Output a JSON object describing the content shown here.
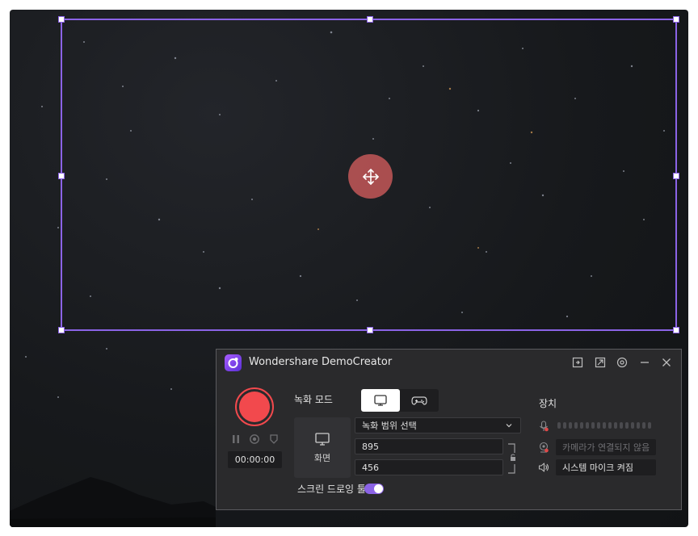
{
  "app": {
    "title": "Wondershare DemoCreator"
  },
  "recording": {
    "timer": "00:00:00"
  },
  "mode": {
    "label": "녹화 모드"
  },
  "area": {
    "screen_label": "화면",
    "select_label": "녹화 범위 선택",
    "width": "895",
    "height": "456"
  },
  "drawing_tool": {
    "label": "스크린 드로잉 툴",
    "enabled": true
  },
  "device": {
    "label": "장치",
    "camera": "카메라가 연결되지 않음",
    "system_audio": "시스템 마이크 켜짐"
  },
  "colors": {
    "accent": "#8b63e6",
    "record": "#f2494d",
    "panel": "#2a2a2c"
  },
  "icons": [
    "move-icon",
    "app-logo-icon",
    "exit-fullscreen-icon",
    "mini-mode-icon",
    "settings-icon",
    "minimize-icon",
    "close-icon",
    "pause-icon",
    "restart-icon",
    "stop-icon",
    "screen-mode-icon",
    "game-mode-icon",
    "monitor-icon",
    "chevron-down-icon",
    "lock-icon",
    "microphone-icon",
    "camera-icon",
    "speaker-icon"
  ]
}
